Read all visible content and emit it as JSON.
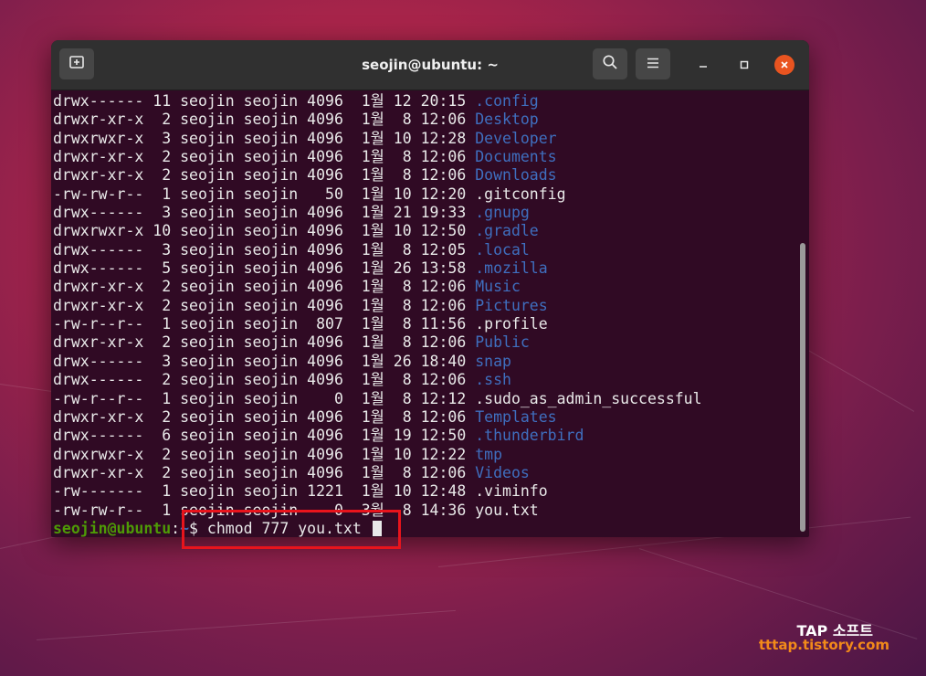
{
  "window": {
    "title": "seojin@ubuntu: ~"
  },
  "icons": {
    "new_tab": "new-tab-icon",
    "search": "search-icon",
    "menu": "hamburger-menu-icon",
    "minimize": "minimize-icon",
    "maximize": "maximize-icon",
    "close": "close-icon"
  },
  "colors": {
    "terminal_bg": "#300a24",
    "directory_text": "#3f6fbf",
    "prompt_user": "#4e9a06",
    "close_button": "#e95420",
    "highlight_box": "#e8141c",
    "watermark_url": "#f28a1a"
  },
  "listing": [
    {
      "text": "drwx------ 11 seojin seojin 4096  1월 12 20:15 ",
      "name": ".config",
      "dir": true
    },
    {
      "text": "drwxr-xr-x  2 seojin seojin 4096  1월  8 12:06 ",
      "name": "Desktop",
      "dir": true
    },
    {
      "text": "drwxrwxr-x  3 seojin seojin 4096  1월 10 12:28 ",
      "name": "Developer",
      "dir": true
    },
    {
      "text": "drwxr-xr-x  2 seojin seojin 4096  1월  8 12:06 ",
      "name": "Documents",
      "dir": true
    },
    {
      "text": "drwxr-xr-x  2 seojin seojin 4096  1월  8 12:06 ",
      "name": "Downloads",
      "dir": true
    },
    {
      "text": "-rw-rw-r--  1 seojin seojin   50  1월 10 12:20 ",
      "name": ".gitconfig",
      "dir": false
    },
    {
      "text": "drwx------  3 seojin seojin 4096  1월 21 19:33 ",
      "name": ".gnupg",
      "dir": true
    },
    {
      "text": "drwxrwxr-x 10 seojin seojin 4096  1월 10 12:50 ",
      "name": ".gradle",
      "dir": true
    },
    {
      "text": "drwx------  3 seojin seojin 4096  1월  8 12:05 ",
      "name": ".local",
      "dir": true
    },
    {
      "text": "drwx------  5 seojin seojin 4096  1월 26 13:58 ",
      "name": ".mozilla",
      "dir": true
    },
    {
      "text": "drwxr-xr-x  2 seojin seojin 4096  1월  8 12:06 ",
      "name": "Music",
      "dir": true
    },
    {
      "text": "drwxr-xr-x  2 seojin seojin 4096  1월  8 12:06 ",
      "name": "Pictures",
      "dir": true
    },
    {
      "text": "-rw-r--r--  1 seojin seojin  807  1월  8 11:56 ",
      "name": ".profile",
      "dir": false
    },
    {
      "text": "drwxr-xr-x  2 seojin seojin 4096  1월  8 12:06 ",
      "name": "Public",
      "dir": true
    },
    {
      "text": "drwx------  3 seojin seojin 4096  1월 26 18:40 ",
      "name": "snap",
      "dir": true
    },
    {
      "text": "drwx------  2 seojin seojin 4096  1월  8 12:06 ",
      "name": ".ssh",
      "dir": true
    },
    {
      "text": "-rw-r--r--  1 seojin seojin    0  1월  8 12:12 ",
      "name": ".sudo_as_admin_successful",
      "dir": false
    },
    {
      "text": "drwxr-xr-x  2 seojin seojin 4096  1월  8 12:06 ",
      "name": "Templates",
      "dir": true
    },
    {
      "text": "drwx------  6 seojin seojin 4096  1월 19 12:50 ",
      "name": ".thunderbird",
      "dir": true
    },
    {
      "text": "drwxrwxr-x  2 seojin seojin 4096  1월 10 12:22 ",
      "name": "tmp",
      "dir": true
    },
    {
      "text": "drwxr-xr-x  2 seojin seojin 4096  1월  8 12:06 ",
      "name": "Videos",
      "dir": true
    },
    {
      "text": "-rw-------  1 seojin seojin 1221  1월 10 12:48 ",
      "name": ".viminfo",
      "dir": false
    },
    {
      "text": "-rw-rw-r--  1 seojin seojin    0  3월  8 14:36 ",
      "name": "you.txt",
      "dir": false
    }
  ],
  "prompt": {
    "user_host": "seojin@ubuntu",
    "colon": ":",
    "path": "~",
    "symbol": "$ ",
    "command": "chmod 777 you.txt "
  },
  "watermark": {
    "title": "TAP 소프트",
    "url": "tttap.tistory.com"
  }
}
